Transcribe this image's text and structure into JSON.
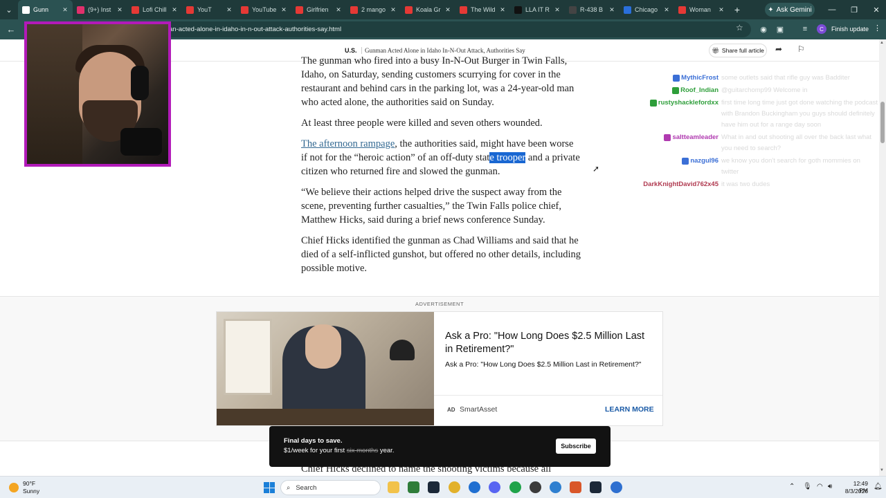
{
  "browser": {
    "tabs": [
      {
        "label": "Gunn",
        "color": "#ffffff",
        "active": true
      },
      {
        "label": "(9+) Inst",
        "color": "#e1306c"
      },
      {
        "label": "Lofi Chill",
        "color": "#e53935"
      },
      {
        "label": "YouT",
        "color": "#e53935"
      },
      {
        "label": "YouTube",
        "color": "#e53935"
      },
      {
        "label": "Girlfrien",
        "color": "#e53935"
      },
      {
        "label": "2 mango",
        "color": "#e53935"
      },
      {
        "label": "Koala Gr",
        "color": "#e53935"
      },
      {
        "label": "The Wild",
        "color": "#e53935"
      },
      {
        "label": "LLA IT R",
        "color": "#111111"
      },
      {
        "label": "R-438 B",
        "color": "#444444"
      },
      {
        "label": "Chicago",
        "color": "#2a6fdb"
      },
      {
        "label": "Woman",
        "color": "#e53935"
      }
    ],
    "ask_gemini_label": "Ask Gemini",
    "url": "an-acted-alone-in-idaho-in-n-out-attack-authorities-say.html",
    "finish_update_label": "Finish update",
    "profile_initial": "C"
  },
  "article_header": {
    "section": "U.S.",
    "headline": "Gunman Acted Alone in Idaho In-N-Out Attack, Authorities Say",
    "share_full_label": "Share full article"
  },
  "article": {
    "p1": "The gunman who fired into a busy In-N-Out Burger in Twin Falls, Idaho, on Saturday, sending customers scurrying for cover in the restaurant and behind cars in the parking lot, was a 24-year-old man who acted alone, the authorities said on Sunday.",
    "p2": "At least three people were killed and seven others wounded.",
    "p3_link": "The afternoon rampage",
    "p3_a": ", the authorities said, might have been worse if not for the “heroic action” of an off-duty stat",
    "p3_highlight": "e trooper",
    "p3_b": " and a private citizen who returned fire and slowed the gunman.",
    "p4": "“We believe their actions helped drive the suspect away from the scene, preventing further casualties,” the Twin Falls police chief, Matthew Hicks, said during a brief news conference Sunday.",
    "p5": "Chief Hicks identified the gunman as Chad Williams and said that he died of a self-inflicted gunshot, but offered no other details, including possible motive.",
    "tail": "Chief Hicks declined to name the shooting victims because all"
  },
  "chat": [
    {
      "name": "MythicFrost",
      "color": "#3b6fd6",
      "message": "some outlets said that rifle guy was Badditer"
    },
    {
      "name": "Roof_Indian",
      "color": "#2e9e3a",
      "message": "@guitarchomp99 Welcome in"
    },
    {
      "name": "rustyshacklefordxx",
      "color": "#2e9e3a",
      "message": "first time long time just got done watching the podcast with Brandon Buckingham you guys should definitely have him out for a range day soon"
    },
    {
      "name": "saltteamleader",
      "color": "#b03ab0",
      "message": "What in and out shooting all over the back last what you need to search?"
    },
    {
      "name": "nazgul96",
      "color": "#3b6fd6",
      "message": "we know you don't search for goth mommies on twitter"
    },
    {
      "name": "DarkKnightDavid762x45",
      "color": "#b03a50",
      "message": "it was two dudes"
    }
  ],
  "ad": {
    "label": "ADVERTISEMENT",
    "title": "Ask a Pro: \"How Long Does $2.5 Million Last in Retirement?\"",
    "subtitle": "Ask a Pro: \"How Long Does $2.5 Million Last in Retirement?\"",
    "tag": "AD",
    "brand": "SmartAsset",
    "cta": "LEARN MORE"
  },
  "toast": {
    "title": "Final days to save.",
    "offer_prefix": "$1/week for your first ",
    "offer_strike": "six months",
    "offer_suffix": " year.",
    "button": "Subscribe"
  },
  "taskbar": {
    "temperature": "90°F",
    "condition": "Sunny",
    "search_placeholder": "Search",
    "time": "12:49 PM",
    "date": "8/3/2026"
  }
}
